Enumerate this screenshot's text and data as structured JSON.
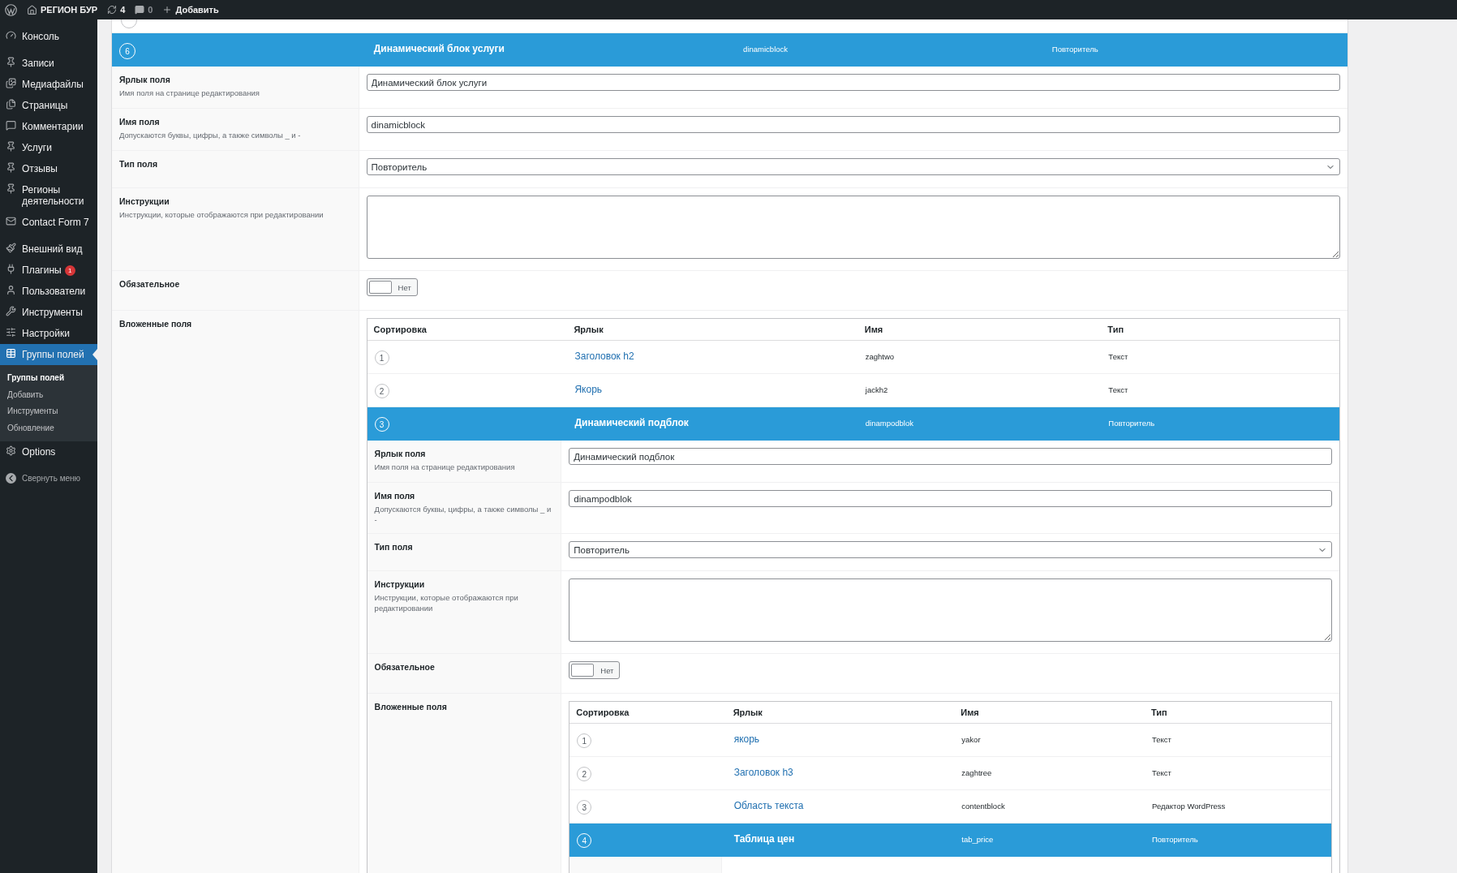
{
  "admin_bar": {
    "site_name": "РЕГИОН БУР",
    "updates": "4",
    "comments": "0",
    "new_label": "Добавить"
  },
  "sidebar": {
    "groups": [
      [
        {
          "label": "Консоль",
          "selected": false
        }
      ],
      [
        {
          "label": "Записи",
          "selected": false
        },
        {
          "label": "Медиафайлы",
          "selected": false
        },
        {
          "label": "Страницы",
          "selected": false
        },
        {
          "label": "Комментарии",
          "selected": false
        },
        {
          "label": "Услуги",
          "selected": false
        },
        {
          "label": "Отзывы",
          "selected": false
        },
        {
          "label": "Регионы деятельности",
          "selected": false
        },
        {
          "label": "Contact Form 7",
          "selected": false
        }
      ],
      [
        {
          "label": "Внешний вид",
          "selected": false
        },
        {
          "label": "Плагины",
          "badge": "1",
          "selected": false
        },
        {
          "label": "Пользователи",
          "selected": false
        },
        {
          "label": "Инструменты",
          "selected": false
        },
        {
          "label": "Настройки",
          "selected": false
        },
        {
          "label": "Группы полей",
          "selected": true,
          "submenu": [
            {
              "label": "Группы полей",
              "selected": true
            },
            {
              "label": "Добавить",
              "selected": false
            },
            {
              "label": "Инструменты",
              "selected": false
            },
            {
              "label": "Обновление",
              "selected": false
            }
          ]
        },
        {
          "label": "Options",
          "selected": false
        }
      ]
    ],
    "collapse_label": "Свернуть меню"
  },
  "editor": {
    "header": {
      "order": "6",
      "label": "Динамический блок услуги",
      "name": "dinamicblock",
      "type": "Повторитель",
      "selected": true
    },
    "settings": [
      {
        "kind": "text",
        "label": "Ярлык поля",
        "description": "Имя поля на странице редактирования",
        "value": "Динамический блок услуги"
      },
      {
        "kind": "text",
        "label": "Имя поля",
        "description": "Допускаются буквы, цифры, а также символы _ и -",
        "value": "dinamicblock"
      },
      {
        "kind": "select",
        "label": "Тип поля",
        "value": "Повторитель"
      },
      {
        "kind": "textarea",
        "label": "Инструкции",
        "description": "Инструкции, которые отображаются при редактировании"
      },
      {
        "kind": "toggle",
        "label": "Обязательное",
        "on": false,
        "state_text": "Нет"
      },
      {
        "kind": "subfields",
        "label": "Вложенные поля",
        "columns": [
          "Сортировка",
          "Ярлык",
          "Имя",
          "Тип"
        ],
        "rows": [
          {
            "order": "1",
            "label": "Заголовок h2",
            "name": "zaghtwo",
            "type": "Текст",
            "selected": false,
            "expanded": false
          },
          {
            "order": "2",
            "label": "Якорь",
            "name": "jackh2",
            "type": "Текст",
            "selected": false,
            "expanded": false
          },
          {
            "order": "3",
            "label": "Динамический подблок",
            "name": "dinampodblok",
            "type": "Повторитель",
            "selected": true,
            "expanded": true,
            "settings": [
              {
                "kind": "text",
                "label": "Ярлык поля",
                "description": "Имя поля на странице редактирования",
                "value": "Динамический подблок"
              },
              {
                "kind": "text",
                "label": "Имя поля",
                "description": "Допускаются буквы, цифры, а также символы _ и -",
                "value": "dinampodblok"
              },
              {
                "kind": "select",
                "label": "Тип поля",
                "value": "Повторитель"
              },
              {
                "kind": "textarea",
                "label": "Инструкции",
                "description": "Инструкции, которые отображаются при редактировании"
              },
              {
                "kind": "toggle",
                "label": "Обязательное",
                "on": false,
                "state_text": "Нет"
              },
              {
                "kind": "subfields",
                "label": "Вложенные поля",
                "columns": [
                  "Сортировка",
                  "Ярлык",
                  "Имя",
                  "Тип"
                ],
                "rows": [
                  {
                    "order": "1",
                    "label": "якорь",
                    "name": "yakor",
                    "type": "Текст",
                    "selected": false,
                    "expanded": false
                  },
                  {
                    "order": "2",
                    "label": "Заголовок h3",
                    "name": "zaghtree",
                    "type": "Текст",
                    "selected": false,
                    "expanded": false
                  },
                  {
                    "order": "3",
                    "label": "Область текста",
                    "name": "contentblock",
                    "type": "Редактор WordPress",
                    "selected": false,
                    "expanded": false
                  },
                  {
                    "order": "4",
                    "label": "Таблица цен",
                    "name": "tab_price",
                    "type": "Повторитель",
                    "selected": true,
                    "expanded": true
                  }
                ]
              }
            ]
          }
        ]
      }
    ]
  }
}
